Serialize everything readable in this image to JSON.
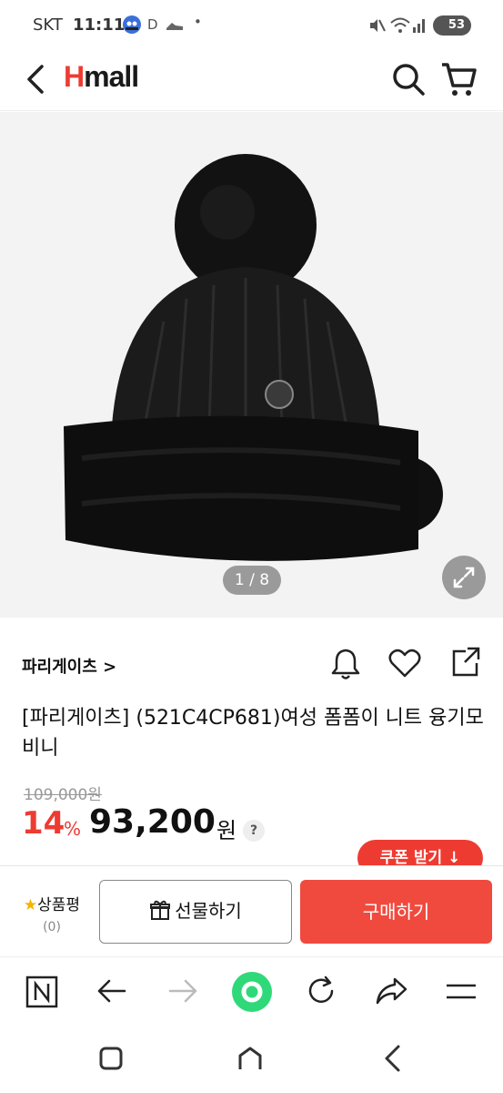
{
  "status_bar": {
    "carrier": "SKT",
    "time": "11:11",
    "notif_d": "D",
    "dot": "•",
    "battery": "53"
  },
  "header": {
    "logo_h": "H",
    "logo_rest": "mall"
  },
  "gallery": {
    "page_indicator": "1 / 8"
  },
  "product": {
    "brand": "파리게이츠 >",
    "title": "[파리게이츠] (521C4CP681)여성 폼폼이 니트 융기모 비니",
    "original_price": "109,000원",
    "discount": "14",
    "discount_sign": "%",
    "price": "93,200",
    "currency": "원",
    "help": "?",
    "coupon_label": "쿠폰 받기 ↓"
  },
  "buy_bar": {
    "review_label": "상품평",
    "review_count": "(0)",
    "gift_label": "선물하기",
    "buy_label": "구매하기"
  },
  "colors": {
    "accent": "#ee3b32",
    "buy_button": "#f04a3f",
    "browser_home": "#2fd97a"
  }
}
